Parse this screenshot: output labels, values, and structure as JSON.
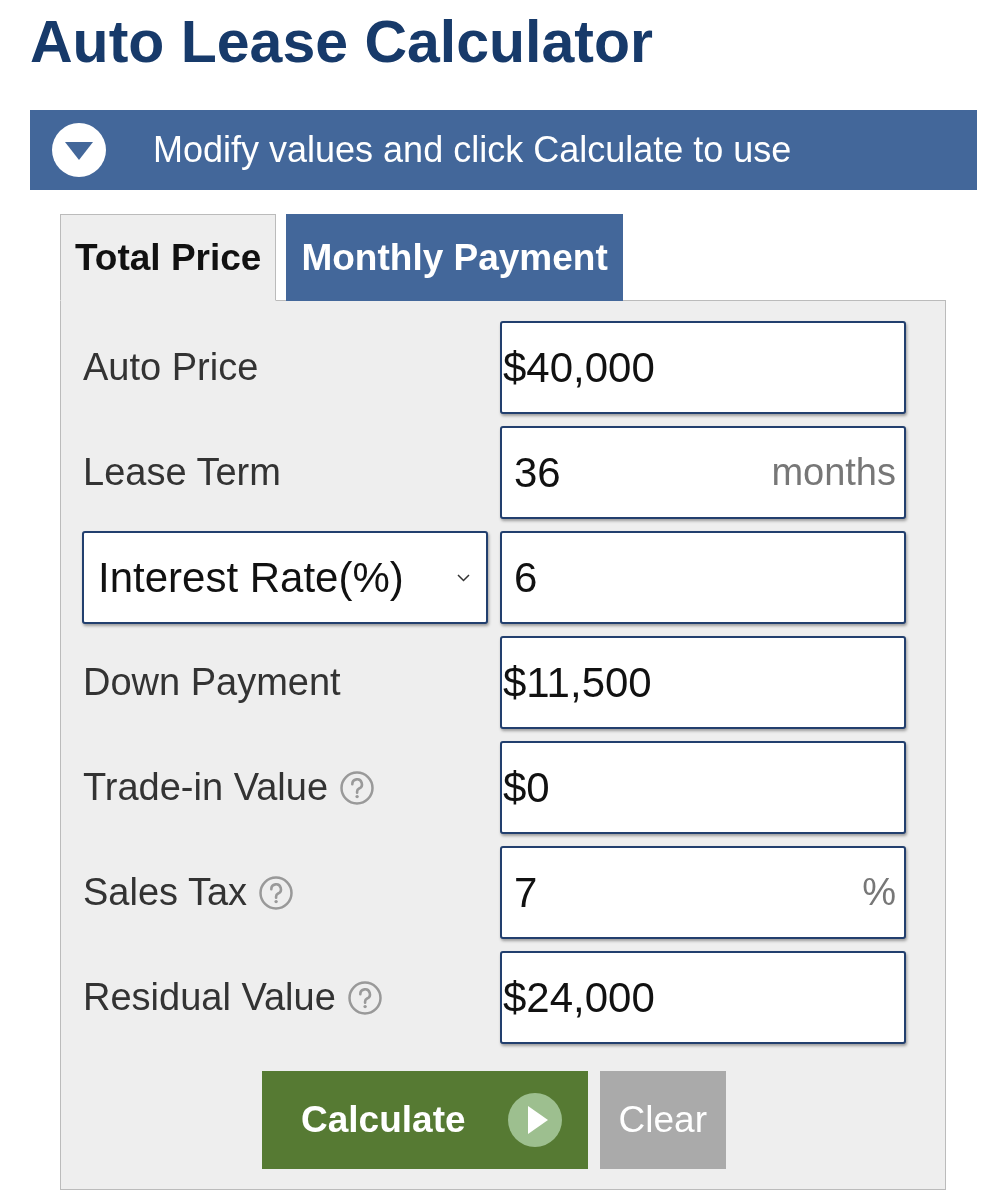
{
  "title": "Auto Lease Calculator",
  "banner": {
    "text": "Modify values and click Calculate to use"
  },
  "tabs": [
    {
      "label": "Total Price",
      "selected": true
    },
    {
      "label": "Monthly Payment",
      "selected": false
    }
  ],
  "fields": [
    {
      "kind": "money",
      "label": "Auto Price",
      "help": false,
      "value": "$40,000"
    },
    {
      "kind": "number",
      "label": "Lease Term",
      "help": false,
      "value": "36",
      "unit": "months"
    },
    {
      "kind": "select",
      "selected_option": "Interest Rate(%)",
      "value": "6"
    },
    {
      "kind": "money",
      "label": "Down Payment",
      "help": false,
      "value": "$11,500"
    },
    {
      "kind": "money",
      "label": "Trade-in Value",
      "help": true,
      "value": "$0"
    },
    {
      "kind": "number",
      "label": "Sales Tax",
      "help": true,
      "value": "7",
      "unit": "%"
    },
    {
      "kind": "money",
      "label": "Residual Value",
      "help": true,
      "value": "$24,000"
    }
  ],
  "buttons": [
    {
      "kind": "primary",
      "label": "Calculate"
    },
    {
      "kind": "secondary",
      "label": "Clear"
    }
  ]
}
